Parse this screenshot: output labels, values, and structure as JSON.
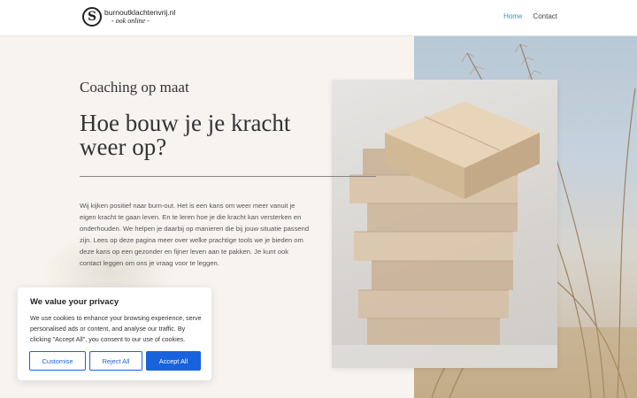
{
  "header": {
    "logo_letter": "S",
    "site_name": "burnoutklachtenvrij.nl",
    "tagline": "- ook online -",
    "nav": [
      {
        "label": "Home",
        "active": true
      },
      {
        "label": "Contact",
        "active": false
      }
    ]
  },
  "hero": {
    "kicker": "Coaching op maat",
    "headline": "Hoe bouw je je kracht weer op?",
    "body": "Wij kijken positief naar burn-out. Het is een kans om weer meer vanuit je eigen kracht te gaan leven. En te leren hoe je die kracht kan versterken en onderhouden. We helpen je daarbij op manieren die bij jouw situatie passend zijn. Lees op deze pagina meer over welke prachtige tools we je bieden om deze kans op een gezonder en fijner leven aan te pakken. Je kunt ook contact leggen om ons je vraag voor te leggen."
  },
  "cookie_banner": {
    "title": "We value your privacy",
    "text": "We use cookies to enhance your browsing experience, serve personalised ads or content, and analyse our traffic. By clicking \"Accept All\", you consent to our use of cookies.",
    "customise_label": "Customise",
    "reject_label": "Reject All",
    "accept_label": "Accept All"
  },
  "colors": {
    "accent": "#2e99c9",
    "button_blue": "#1863dc",
    "page_bg": "#f7f4ef"
  }
}
